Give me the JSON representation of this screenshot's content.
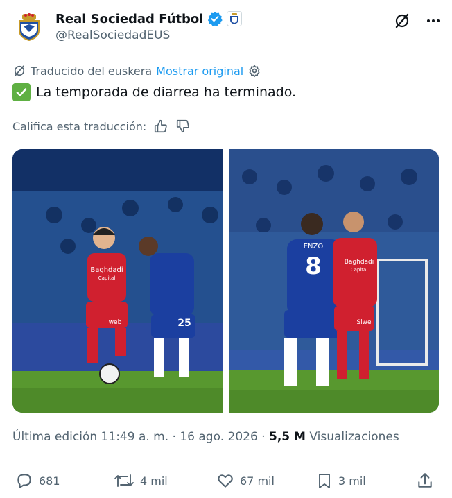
{
  "account": {
    "display_name": "Real Sociedad Fútbol",
    "handle": "@RealSociedadEUS"
  },
  "translation": {
    "note": "Traducido del euskera",
    "show_original": "Mostrar original"
  },
  "tweet": {
    "text": "La temporada de diarrea ha terminado."
  },
  "rate": {
    "label": "Califica esta traducción:"
  },
  "photos": {
    "left": {
      "jersey_sponsor": "Baghdadi",
      "jersey_sponsor_sub": "Capital",
      "shorts_sponsor": "web",
      "opponent_number": "25"
    },
    "right": {
      "player_name": "ENZO",
      "player_number": "8",
      "jersey_sponsor": "Baghdadi",
      "jersey_sponsor_sub": "Capital",
      "shorts_sponsor": "Siwe"
    }
  },
  "meta": {
    "edited": "Última edición 11:49 a. m. · 16 ago. 2026 ·",
    "views_count": "5,5 M",
    "views_label": "Visualizaciones"
  },
  "actions": {
    "replies": "681",
    "reposts": "4 mil",
    "likes": "67 mil",
    "bookmarks": "3 mil"
  },
  "colors": {
    "link": "#1d9bf0",
    "secondary_text": "#536471",
    "verified": "#1d9bf0",
    "check_emoji": "#5fb043",
    "pitch": "#4f8f2f",
    "chelsea_blue": "#1b3fa0",
    "sociedad_red": "#d0202f"
  },
  "icons": [
    "verified-badge-icon",
    "affiliate-badge-icon",
    "grok-icon",
    "more-icon",
    "translate-icon",
    "settings-icon",
    "thumbs-up-icon",
    "thumbs-down-icon",
    "reply-icon",
    "repost-icon",
    "like-icon",
    "bookmark-icon",
    "share-icon"
  ]
}
